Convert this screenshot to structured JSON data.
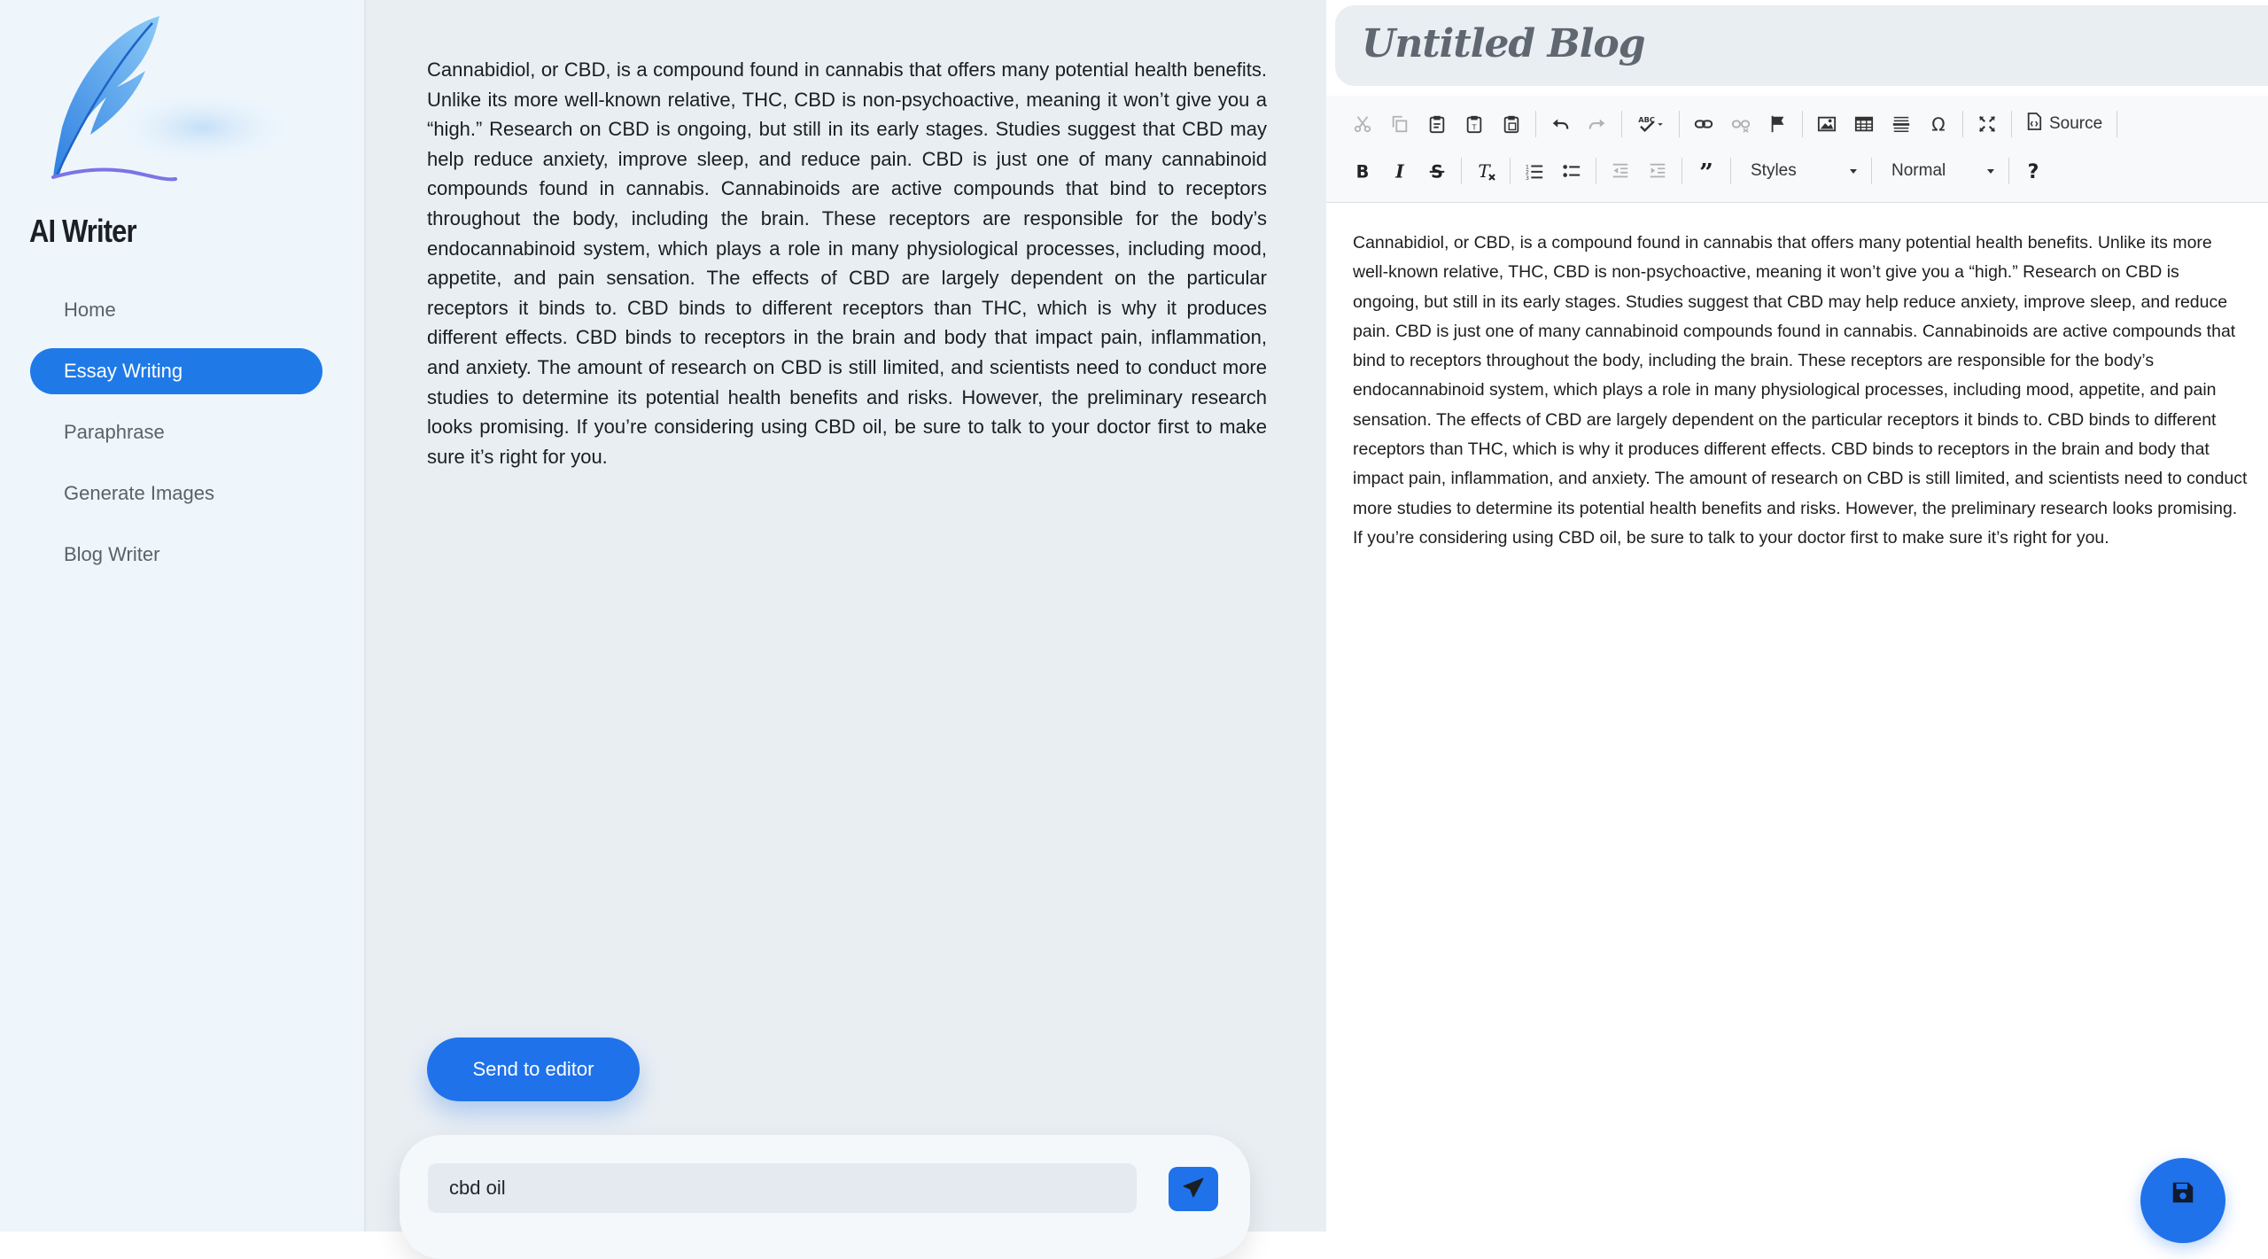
{
  "app": {
    "title": "AI Writer"
  },
  "sidebar": {
    "items": [
      {
        "label": "Home",
        "active": false
      },
      {
        "label": "Essay Writing",
        "active": true
      },
      {
        "label": "Paraphrase",
        "active": false
      },
      {
        "label": "Generate Images",
        "active": false
      },
      {
        "label": "Blog Writer",
        "active": false
      }
    ]
  },
  "essay": {
    "text": "Cannabidiol, or CBD, is a compound found in cannabis that offers many potential health benefits. Unlike its more well-known relative, THC, CBD is non-psychoactive, meaning it won’t give you a “high.” Research on CBD is ongoing, but still in its early stages. Studies suggest that CBD may help reduce anxiety, improve sleep, and reduce pain. CBD is just one of many cannabinoid compounds found in cannabis. Cannabinoids are active compounds that bind to receptors throughout the body, including the brain. These receptors are responsible for the body’s endocannabinoid system, which plays a role in many physiological processes, including mood, appetite, and pain sensation. The effects of CBD are largely dependent on the particular receptors it binds to. CBD binds to different receptors than THC, which is why it produces different effects. CBD binds to receptors in the brain and body that impact pain, inflammation, and anxiety. The amount of research on CBD is still limited, and scientists need to conduct more studies to determine its potential health benefits and risks. However, the preliminary research looks promising. If you’re considering using CBD oil, be sure to talk to your doctor first to make sure it’s right for you."
  },
  "send_button": {
    "label": "Send to editor"
  },
  "prompt": {
    "value": "cbd oil"
  },
  "editor": {
    "title": "Untitled Blog",
    "toolbar": {
      "source_label": "Source",
      "styles_label": "Styles",
      "format_label": "Normal"
    },
    "body": "Cannabidiol, or CBD, is a compound found in cannabis that offers many potential health benefits. Unlike its more well-known relative, THC, CBD is non-psychoactive, meaning it won’t give you a “high.” Research on CBD is ongoing, but still in its early stages. Studies suggest that CBD may help reduce anxiety, improve sleep, and reduce pain. CBD is just one of many cannabinoid compounds found in cannabis. Cannabinoids are active compounds that bind to receptors throughout the body, including the brain. These receptors are responsible for the body’s endocannabinoid system, which plays a role in many physiological processes, including mood, appetite, and pain sensation. The effects of CBD are largely dependent on the particular receptors it binds to. CBD binds to different receptors than THC, which is why it produces different effects. CBD binds to receptors in the brain and body that impact pain, inflammation, and anxiety. The amount of research on CBD is still limited, and scientists need to conduct more studies to determine its potential health benefits and risks. However, the preliminary research looks promising. If you’re considering using CBD oil, be sure to talk to your doctor first to make sure it’s right for you."
  },
  "colors": {
    "accent": "#1f72ea",
    "sidebar_bg": "#eef6fc",
    "panel_bg": "#e9eef3"
  },
  "icons": [
    "feather-logo",
    "paper-plane-icon",
    "save-icon"
  ]
}
